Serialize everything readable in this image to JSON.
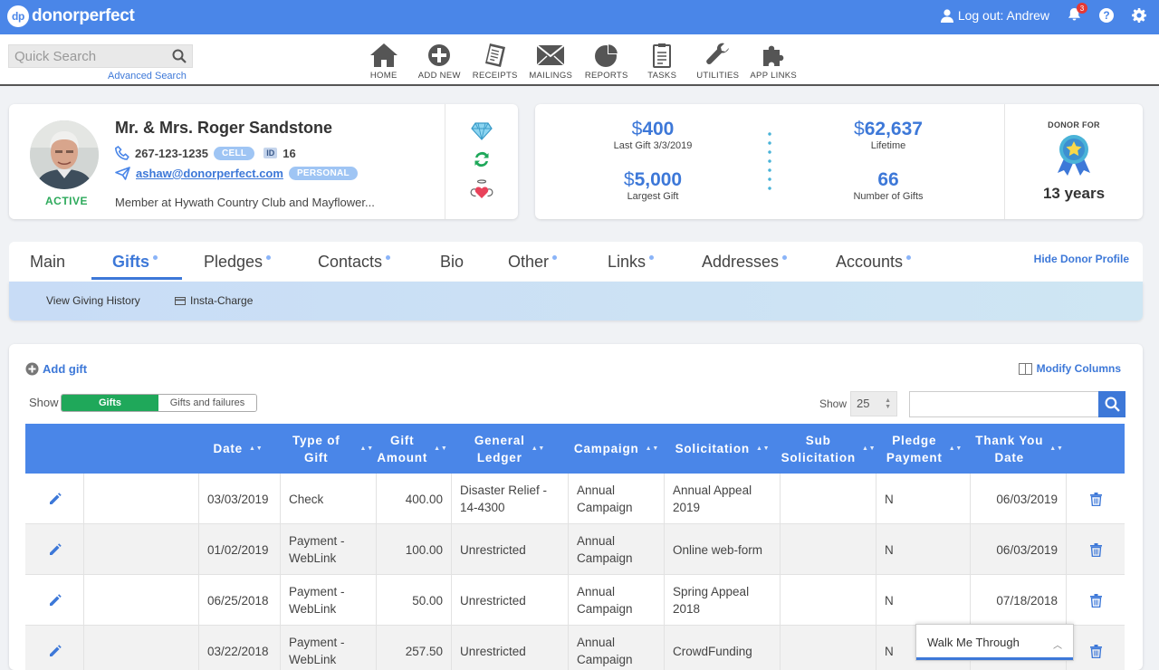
{
  "app": {
    "name": "donorperfect",
    "logo_mark": "dp"
  },
  "topbar": {
    "logout_label": "Log out: Andrew",
    "notification_count": "3",
    "help_label": "?"
  },
  "search": {
    "placeholder": "Quick Search",
    "advanced_label": "Advanced Search"
  },
  "nav": [
    {
      "label": "HOME",
      "icon": "home-icon"
    },
    {
      "label": "ADD NEW",
      "icon": "plus-circle-icon"
    },
    {
      "label": "RECEIPTS",
      "icon": "receipt-icon"
    },
    {
      "label": "MAILINGS",
      "icon": "envelope-icon"
    },
    {
      "label": "REPORTS",
      "icon": "pie-chart-icon"
    },
    {
      "label": "TASKS",
      "icon": "clipboard-icon"
    },
    {
      "label": "UTILITIES",
      "icon": "wrench-icon"
    },
    {
      "label": "APP LINKS",
      "icon": "puzzle-icon"
    }
  ],
  "donor": {
    "status": "ACTIVE",
    "name": "Mr. & Mrs. Roger Sandstone",
    "phone": "267-123-1235",
    "phone_type": "CELL",
    "id_label": "ID",
    "id": "16",
    "email": "ashaw@donorperfect.com",
    "email_type": "PERSONAL",
    "membership": "Member at Hywath Country Club and Mayflower..."
  },
  "stats": {
    "currency": "$",
    "last_gift": "400",
    "last_gift_label": "Last Gift 3/3/2019",
    "largest_gift": "5,000",
    "largest_gift_label": "Largest Gift",
    "lifetime": "62,637",
    "lifetime_label": "Lifetime",
    "num_gifts": "66",
    "num_gifts_label": "Number of Gifts",
    "donor_for_label": "DONOR FOR",
    "donor_for": "13 years"
  },
  "tabs": [
    {
      "label": "Main",
      "dot": false
    },
    {
      "label": "Gifts",
      "dot": true,
      "active": true
    },
    {
      "label": "Pledges",
      "dot": true
    },
    {
      "label": "Contacts",
      "dot": true
    },
    {
      "label": "Bio",
      "dot": false
    },
    {
      "label": "Other",
      "dot": true
    },
    {
      "label": "Links",
      "dot": true
    },
    {
      "label": "Addresses",
      "dot": true
    },
    {
      "label": "Accounts",
      "dot": true
    }
  ],
  "hide_profile_label": "Hide Donor Profile",
  "subnav": {
    "view_history": "View Giving History",
    "insta_charge": "Insta-Charge"
  },
  "gifts": {
    "add_label": "Add gift",
    "modify_columns": "Modify Columns",
    "show_label": "Show",
    "toggle_on": "Gifts",
    "toggle_off": "Gifts and failures",
    "page_size_label": "Show",
    "page_size": "25",
    "columns": [
      {
        "l1": "Date",
        "l2": ""
      },
      {
        "l1": "Type of Gift",
        "l2": ""
      },
      {
        "l1": "Gift",
        "l2": "Amount"
      },
      {
        "l1": "General",
        "l2": "Ledger"
      },
      {
        "l1": "Campaign",
        "l2": ""
      },
      {
        "l1": "Solicitation",
        "l2": ""
      },
      {
        "l1": "Sub",
        "l2": "Solicitation"
      },
      {
        "l1": "Pledge",
        "l2": "Payment"
      },
      {
        "l1": "Thank You",
        "l2": "Date"
      }
    ],
    "rows": [
      {
        "date": "03/03/2019",
        "type": "Check",
        "amount": "400.00",
        "ledger": "Disaster Relief - 14-4300",
        "campaign": "Annual Campaign",
        "solicitation": "Annual Appeal 2019",
        "sub": "",
        "pledge": "N",
        "thanks": "06/03/2019"
      },
      {
        "date": "01/02/2019",
        "type": "Payment - WebLink",
        "amount": "100.00",
        "ledger": "Unrestricted",
        "campaign": "Annual Campaign",
        "solicitation": "Online web-form",
        "sub": "",
        "pledge": "N",
        "thanks": "06/03/2019"
      },
      {
        "date": "06/25/2018",
        "type": "Payment - WebLink",
        "amount": "50.00",
        "ledger": "Unrestricted",
        "campaign": "Annual Campaign",
        "solicitation": "Spring Appeal 2018",
        "sub": "",
        "pledge": "N",
        "thanks": "07/18/2018"
      },
      {
        "date": "03/22/2018",
        "type": "Payment - WebLink",
        "amount": "257.50",
        "ledger": "Unrestricted",
        "campaign": "Annual Campaign",
        "solicitation": "CrowdFunding",
        "sub": "",
        "pledge": "N",
        "thanks": ""
      }
    ]
  },
  "walkme": {
    "label": "Walk Me Through"
  },
  "colors": {
    "primary": "#4a86e8",
    "link": "#3d78d8",
    "active_green": "#2eaa5c"
  }
}
